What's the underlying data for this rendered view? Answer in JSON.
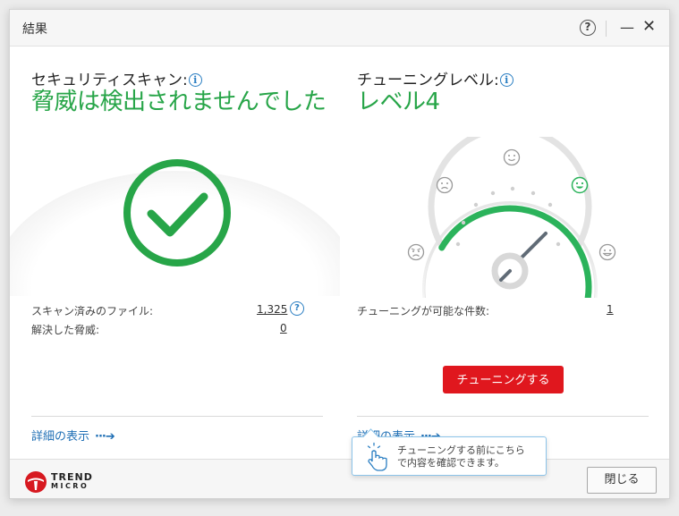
{
  "window": {
    "title": "結果",
    "help_label": "?",
    "minimize_label": "—",
    "close_label": "✕"
  },
  "scan": {
    "heading": "セキュリティスキャン:",
    "result": "脅威は検出されませんでした",
    "scanned_files_label": "スキャン済みのファイル:",
    "scanned_files_value": "1,325",
    "resolved_label": "解決した脅威:",
    "resolved_value": "0",
    "details_link": "詳細の表示",
    "status_icon": "checkmark-circle-icon",
    "accent_color": "#27a548"
  },
  "tuning": {
    "heading": "チューニングレベル:",
    "level": "レベル4",
    "level_value": 4,
    "level_max": 5,
    "available_label": "チューニングが可能な件数:",
    "available_value": "1",
    "tune_button": "チューニングする",
    "details_link": "詳細の表示",
    "tooltip": {
      "line1": "チューニングする前にこちら",
      "line2": "で内容を確認できます。"
    },
    "button_color": "#e0171e"
  },
  "footer": {
    "brand_line1": "TREND",
    "brand_line2": "MICRO",
    "close_button": "閉じる"
  }
}
